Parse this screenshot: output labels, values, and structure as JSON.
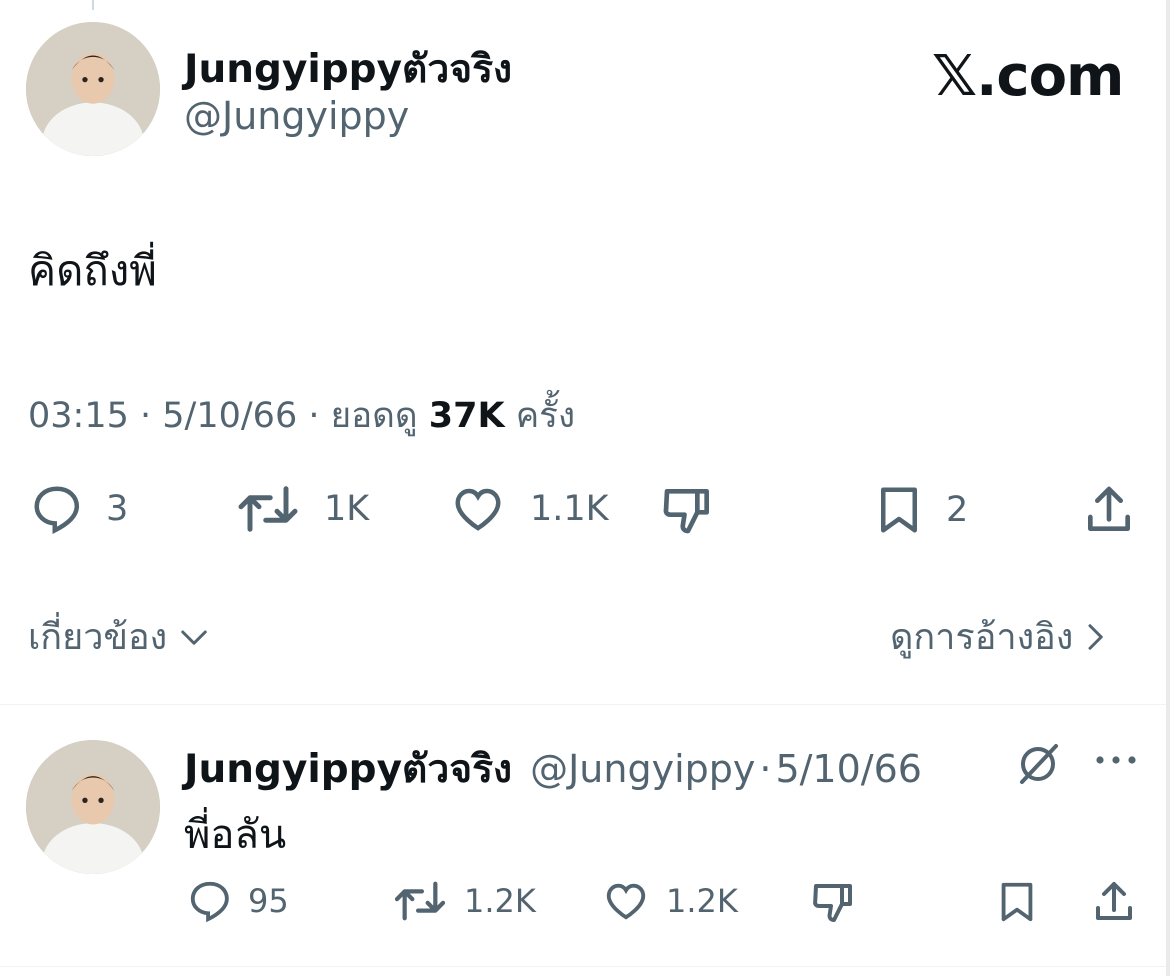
{
  "header": {
    "display_name": "Jungyippyตัวจริง",
    "handle": "@Jungyippy",
    "brand": "𝕏.com"
  },
  "tweet": {
    "text": "คิดถึงพี่",
    "time": "03:15",
    "date": "5/10/66",
    "views_label": "ยอดดู",
    "views": "37K",
    "views_suffix": "ครั้ง",
    "replies": "3",
    "retweets": "1K",
    "likes": "1.1K",
    "bookmarks": "2"
  },
  "links": {
    "related": "เกี่ยวข้อง",
    "quotes": "ดูการอ้างอิง"
  },
  "reply": {
    "display_name": "Jungyippyตัวจริง",
    "handle": "@Jungyippy",
    "date": "5/10/66",
    "text": "พี่อลัน",
    "replies": "95",
    "retweets": "1.2K",
    "likes": "1.2K"
  },
  "icons": {
    "reply": "reply-bubble-icon",
    "retweet": "retweet-icon",
    "like": "heart-icon",
    "dislike": "thumbs-down-icon",
    "bookmark": "bookmark-icon",
    "share": "share-icon",
    "grok": "grok-slash-icon",
    "more": "more-dots-icon"
  },
  "colors": {
    "text": "#0f1419",
    "secondary": "#536471",
    "divider": "#eff3f4"
  }
}
